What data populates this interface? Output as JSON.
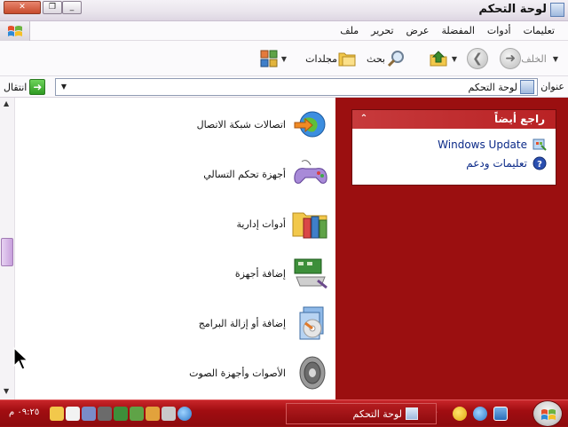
{
  "window": {
    "title": "لوحة التحكم",
    "close_glyph": "✕",
    "maximize_glyph": "❐",
    "minimize_glyph": "_"
  },
  "menu": {
    "items": [
      "ملف",
      "تحرير",
      "عرض",
      "المفضلة",
      "أدوات",
      "تعليمات"
    ]
  },
  "toolbar": {
    "back_label": "الخلف",
    "search_label": "بحث",
    "folders_label": "مجلدات"
  },
  "address": {
    "label": "عنوان",
    "value": "لوحة التحكم",
    "go_label": "انتقال"
  },
  "task_pane": {
    "header": "راجع أيضاً",
    "links": [
      {
        "label": "Windows Update",
        "icon": "windows-update-icon"
      },
      {
        "label": "تعليمات ودعم",
        "icon": "help-icon"
      }
    ]
  },
  "content": {
    "items": [
      {
        "label": "اتصالات شبكة الاتصال",
        "icon": "network-connections-icon"
      },
      {
        "label": "أجهزة تحكم التسالي",
        "icon": "game-controllers-icon"
      },
      {
        "label": "أدوات إدارية",
        "icon": "administrative-tools-icon"
      },
      {
        "label": "إضافة أجهزة",
        "icon": "add-hardware-icon"
      },
      {
        "label": "إضافة أو إزالة البرامج",
        "icon": "add-remove-programs-icon"
      },
      {
        "label": "الأصوات وأجهزة الصوت",
        "icon": "sounds-icon"
      }
    ]
  },
  "taskbar": {
    "window_label": "لوحة التحكم",
    "clock": "٠٩:٢٥ م"
  },
  "colors": {
    "accent": "#9b0f10",
    "link": "#0b2a88"
  }
}
